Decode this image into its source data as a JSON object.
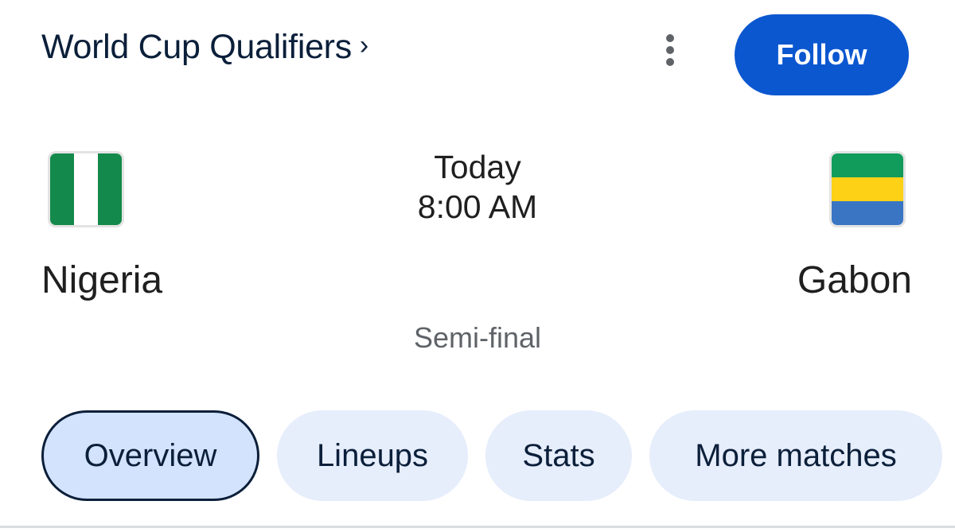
{
  "header": {
    "title": "World Cup Qualifiers",
    "chevron": "›",
    "more_icon": "more-vert-icon",
    "follow_label": "Follow"
  },
  "match": {
    "day": "Today",
    "time": "8:00 AM",
    "round": "Semi-final",
    "home": {
      "name": "Nigeria",
      "flag_colors": [
        "#138a4b",
        "#ffffff",
        "#138a4b"
      ]
    },
    "away": {
      "name": "Gabon",
      "flag_colors": [
        "#129c5b",
        "#fcd116",
        "#3a75c4"
      ]
    }
  },
  "tabs": [
    {
      "label": "Overview",
      "active": true
    },
    {
      "label": "Lineups",
      "active": false
    },
    {
      "label": "Stats",
      "active": false
    },
    {
      "label": "More matches",
      "active": false
    }
  ],
  "colors": {
    "accent": "#0b57d0",
    "tab_bg": "#e6edfb",
    "tab_active_bg": "#d3e3fd"
  }
}
